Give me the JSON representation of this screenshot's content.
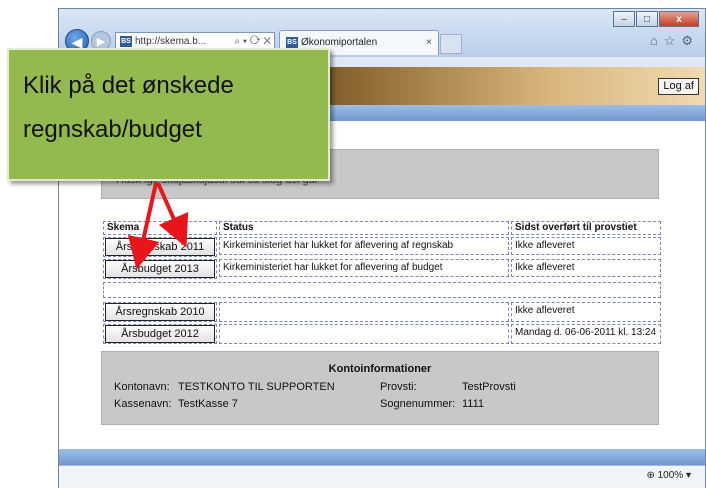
{
  "browser": {
    "address": "http://skema.b...",
    "tab_title": "Økonomiportalen",
    "favicon": "BS",
    "minimize": "–",
    "maximize": "□",
    "close": "x",
    "zoom": "100%"
  },
  "header": {
    "logout_label": "Log af"
  },
  "notice": {
    "text": "Husk ige skujaskujasul sul su slug usi gui"
  },
  "table": {
    "headers": [
      "Skema",
      "Status",
      "Sidst overført til provstiet"
    ],
    "rows": [
      {
        "button": "Årsregnskab 2011",
        "status": "Kirkeministeriet har lukket for aflevering af regnskab",
        "sent": "Ikke afleveret"
      },
      {
        "button": "Årsbudget 2013",
        "status": "Kirkeministeriet har lukket for aflevering af budget",
        "sent": "Ikke afleveret"
      },
      {
        "button": "Årsregnskab 2010",
        "status": "",
        "sent": "Ikke afleveret"
      },
      {
        "button": "Årsbudget 2012",
        "status": "",
        "sent": "Mandag  d. 06-06-2011 kl. 13:24"
      }
    ]
  },
  "account": {
    "title": "Kontoinformationer",
    "kontonavn_label": "Kontonavn:",
    "kontonavn": "TESTKONTO TIL SUPPORTEN",
    "kassenavn_label": "Kassenavn:",
    "kassenavn": "TestKasse 7",
    "provsti_label": "Provsti:",
    "provsti": "TestProvsti",
    "sogn_label": "Sognenummer:",
    "sogn": "1111"
  },
  "callout": {
    "line1": "Klik på det ønskede",
    "line2": "regnskab/budget",
    "arrow_color": "#e8161b"
  }
}
